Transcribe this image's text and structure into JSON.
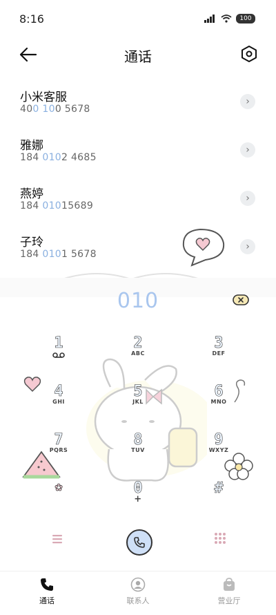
{
  "status": {
    "time": "8:16",
    "battery": "100"
  },
  "header": {
    "title": "通话"
  },
  "contacts": [
    {
      "name": "小米客服",
      "number_parts": [
        "40",
        "0",
        " ",
        "10",
        "0 5678"
      ],
      "highlights": [
        false,
        true,
        false,
        true,
        false
      ]
    },
    {
      "name": "雅娜",
      "number_parts": [
        "184 ",
        "010",
        "2 4685"
      ],
      "highlights": [
        false,
        true,
        false
      ]
    },
    {
      "name": "燕婷",
      "number_parts": [
        "184 ",
        "010",
        "15689"
      ],
      "highlights": [
        false,
        true,
        false
      ]
    },
    {
      "name": "子玲",
      "number_parts": [
        "184 ",
        "010",
        "1 5678"
      ],
      "highlights": [
        false,
        true,
        false
      ]
    }
  ],
  "dialer": {
    "input": "010"
  },
  "keypad": [
    {
      "digit": "1",
      "letters": ""
    },
    {
      "digit": "2",
      "letters": "ABC"
    },
    {
      "digit": "3",
      "letters": "DEF"
    },
    {
      "digit": "4",
      "letters": "GHI"
    },
    {
      "digit": "5",
      "letters": "JKL"
    },
    {
      "digit": "6",
      "letters": "MNO"
    },
    {
      "digit": "7",
      "letters": "PQRS"
    },
    {
      "digit": "8",
      "letters": "TUV"
    },
    {
      "digit": "9",
      "letters": "WXYZ"
    },
    {
      "digit": "✿",
      "letters": ""
    },
    {
      "digit": "0",
      "letters": "+"
    },
    {
      "digit": "#",
      "letters": ""
    }
  ],
  "tabs": [
    {
      "label": "通话",
      "icon": "phone-icon",
      "active": true
    },
    {
      "label": "联系人",
      "icon": "person-icon",
      "active": false
    },
    {
      "label": "营业厅",
      "icon": "shop-bag-icon",
      "active": false
    }
  ],
  "colors": {
    "highlight": "#8ab0e0",
    "dial_text": "#a9c6ee",
    "call_button": "#cfe0f7"
  }
}
